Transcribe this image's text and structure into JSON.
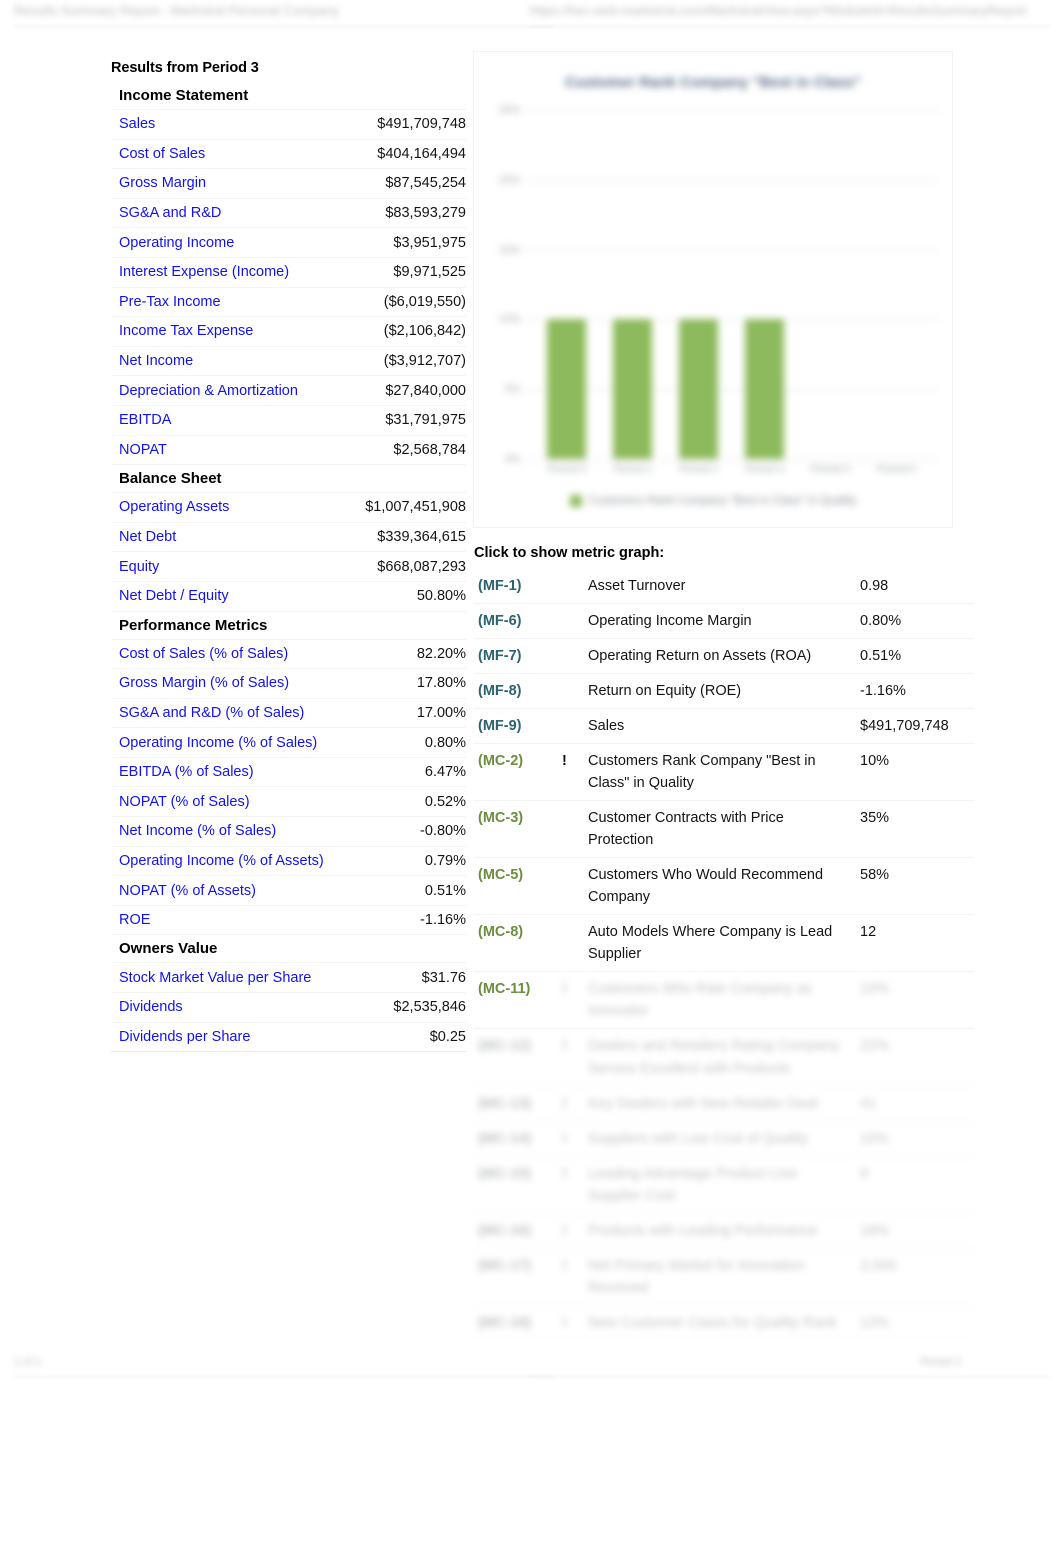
{
  "chrome": {
    "top_left_text": "Results Summary Report - Markstrat Personal Company",
    "top_right_text": "https://hec.web-markstrat.com/MarkstratView.aspx?ModuleId=ResultsSummaryReport",
    "bottom_left_text": "1 of 1",
    "bottom_right_text": "Period 3"
  },
  "report": {
    "title": "Results from Period 3",
    "sections": [
      {
        "heading": "Income Statement",
        "rows": [
          {
            "label": "Sales",
            "value": "$491,709,748"
          },
          {
            "label": "Cost of Sales",
            "value": "$404,164,494"
          },
          {
            "label": "Gross Margin",
            "value": "$87,545,254"
          },
          {
            "label": "SG&A and R&D",
            "value": "$83,593,279"
          },
          {
            "label": "Operating Income",
            "value": "$3,951,975"
          },
          {
            "label": "Interest Expense (Income)",
            "value": "$9,971,525"
          },
          {
            "label": "Pre-Tax Income",
            "value": "($6,019,550)"
          },
          {
            "label": "Income Tax Expense",
            "value": "($2,106,842)"
          },
          {
            "label": "Net Income",
            "value": "($3,912,707)"
          },
          {
            "label": "Depreciation & Amortization",
            "value": "$27,840,000"
          },
          {
            "label": "EBITDA",
            "value": "$31,791,975"
          },
          {
            "label": "NOPAT",
            "value": "$2,568,784"
          }
        ]
      },
      {
        "heading": "Balance Sheet",
        "rows": [
          {
            "label": "Operating Assets",
            "value": "$1,007,451,908"
          },
          {
            "label": "Net Debt",
            "value": "$339,364,615"
          },
          {
            "label": "Equity",
            "value": "$668,087,293"
          },
          {
            "label": "Net Debt / Equity",
            "value": "50.80%"
          }
        ]
      },
      {
        "heading": "Performance Metrics",
        "rows": [
          {
            "label": "Cost of Sales (% of Sales)",
            "value": "82.20%"
          },
          {
            "label": "Gross Margin (% of Sales)",
            "value": "17.80%"
          },
          {
            "label": "SG&A and R&D (% of Sales)",
            "value": "17.00%"
          },
          {
            "label": "Operating Income (% of Sales)",
            "value": "0.80%"
          },
          {
            "label": "EBITDA (% of Sales)",
            "value": "6.47%"
          },
          {
            "label": "NOPAT (% of Sales)",
            "value": "0.52%"
          },
          {
            "label": "Net Income (% of Sales)",
            "value": "-0.80%"
          },
          {
            "label": "Operating Income (% of Assets)",
            "value": "0.79%"
          },
          {
            "label": "NOPAT (% of Assets)",
            "value": "0.51%"
          },
          {
            "label": "ROE",
            "value": "-1.16%"
          }
        ]
      },
      {
        "heading": "Owners Value",
        "rows": [
          {
            "label": "Stock Market Value per Share",
            "value": "$31.76"
          },
          {
            "label": "Dividends",
            "value": "$2,535,846"
          },
          {
            "label": "Dividends per Share",
            "value": "$0.25"
          }
        ]
      }
    ]
  },
  "metrics": {
    "heading": "Click to show metric graph:",
    "rows": [
      {
        "code": "(MF-1)",
        "kind": "mf",
        "flag": "",
        "name": "Asset Turnover",
        "value": "0.98",
        "blur": "none"
      },
      {
        "code": "(MF-6)",
        "kind": "mf",
        "flag": "",
        "name": "Operating Income Margin",
        "value": "0.80%",
        "blur": "none"
      },
      {
        "code": "(MF-7)",
        "kind": "mf",
        "flag": "",
        "name": "Operating Return on Assets (ROA)",
        "value": "0.51%",
        "blur": "none"
      },
      {
        "code": "(MF-8)",
        "kind": "mf",
        "flag": "",
        "name": "Return on Equity (ROE)",
        "value": "-1.16%",
        "blur": "none"
      },
      {
        "code": "(MF-9)",
        "kind": "mf",
        "flag": "",
        "name": "Sales",
        "value": "$491,709,748",
        "blur": "none"
      },
      {
        "code": "(MC-2)",
        "kind": "mc",
        "flag": "!",
        "name": "Customers Rank Company \"Best in Class\" in Quality",
        "value": "10%",
        "blur": "none"
      },
      {
        "code": "(MC-3)",
        "kind": "mc",
        "flag": "",
        "name": "Customer Contracts with Price Protection",
        "value": "35%",
        "blur": "none"
      },
      {
        "code": "(MC-5)",
        "kind": "mc",
        "flag": "",
        "name": "Customers Who Would Recommend Company",
        "value": "58%",
        "blur": "none"
      },
      {
        "code": "(MC-8)",
        "kind": "mc",
        "flag": "",
        "name": "Auto Models Where Company is Lead Supplier",
        "value": "12",
        "blur": "none"
      },
      {
        "code": "(MC-11)",
        "kind": "mc",
        "flag": "!",
        "name": "Customers Who Rate Company as Innovator",
        "value": "10%",
        "blur": "partial"
      },
      {
        "code": "(MC-12)",
        "kind": "mc",
        "flag": "!",
        "name": "Dealers and Retailers Rating Company Service Excellent with Products",
        "value": "22%",
        "blur": "full"
      },
      {
        "code": "(MC-13)",
        "kind": "mc",
        "flag": "!",
        "name": "Key Dealers with New Retailer Deal",
        "value": "41",
        "blur": "full"
      },
      {
        "code": "(MC-14)",
        "kind": "mc",
        "flag": "!",
        "name": "Suppliers with Low Cost of Quality",
        "value": "15%",
        "blur": "full"
      },
      {
        "code": "(MC-15)",
        "kind": "mc",
        "flag": "!",
        "name": "Leading Advantage Product Line Supplier Cost",
        "value": "9",
        "blur": "full"
      },
      {
        "code": "(MC-16)",
        "kind": "mc",
        "flag": "!",
        "name": "Products with Leading Performance",
        "value": "18%",
        "blur": "full"
      },
      {
        "code": "(MC-17)",
        "kind": "mc",
        "flag": "!",
        "name": "Net Primary Market for Innovation Received",
        "value": "2,500",
        "blur": "full"
      },
      {
        "code": "(MC-18)",
        "kind": "mc",
        "flag": "!",
        "name": "New Customer Cases for Quality Rank",
        "value": "12%",
        "blur": "full"
      }
    ]
  },
  "chart_data": {
    "type": "bar",
    "title": "Customer Rank Company \"Best in Class\"",
    "categories": [
      "Period 0",
      "Period 1",
      "Period 2",
      "Period 3",
      "Period 4",
      "Period 5"
    ],
    "values": [
      10,
      10,
      10,
      10,
      null,
      null
    ],
    "series": [
      {
        "name": "Customers Rank Company \"Best in Class\" in Quality",
        "values": [
          10,
          10,
          10,
          10,
          null,
          null
        ]
      }
    ],
    "xlabel": "",
    "ylabel": "",
    "ylim": [
      0,
      25
    ],
    "yticks": [
      "25%",
      "20%",
      "15%",
      "10%",
      "5%",
      "0%"
    ],
    "grid": true,
    "legend_position": "bottom",
    "bar_color": "#8dba5c"
  }
}
